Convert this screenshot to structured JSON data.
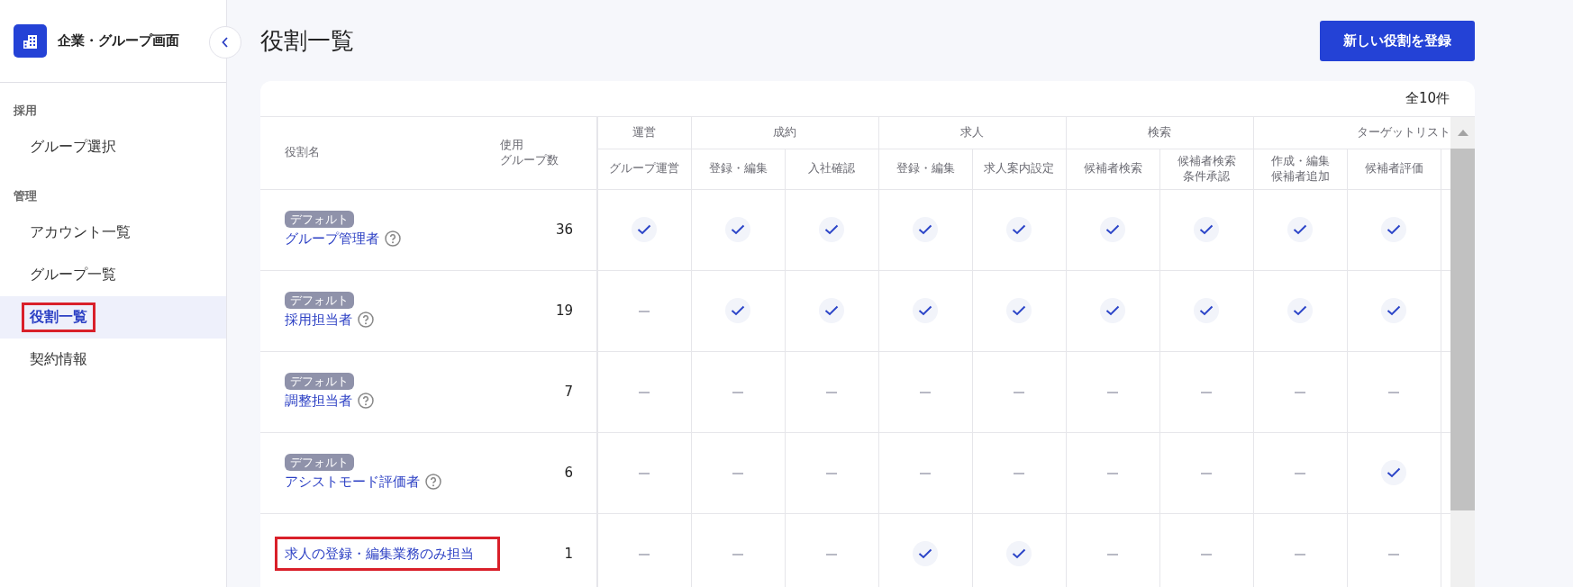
{
  "sidebar": {
    "title": "企業・グループ画面",
    "sections": [
      {
        "label": "採用",
        "items": [
          {
            "label": "グループ選択",
            "selected": false,
            "highlighted": false
          }
        ]
      },
      {
        "label": "管理",
        "items": [
          {
            "label": "アカウント一覧",
            "selected": false,
            "highlighted": false
          },
          {
            "label": "グループ一覧",
            "selected": false,
            "highlighted": false
          },
          {
            "label": "役割一覧",
            "selected": true,
            "highlighted": true
          },
          {
            "label": "契約情報",
            "selected": false,
            "highlighted": false
          }
        ]
      }
    ]
  },
  "page": {
    "title": "役割一覧",
    "primary_button": "新しい役割を登録"
  },
  "table": {
    "total": "全10件",
    "name_header": "役割名",
    "count_header": [
      "使用",
      "グループ数"
    ],
    "groups": [
      {
        "label": "運営",
        "columns": [
          [
            "グループ運営"
          ]
        ]
      },
      {
        "label": "成約",
        "columns": [
          [
            "登録・編集"
          ],
          [
            "入社確認"
          ]
        ]
      },
      {
        "label": "求人",
        "columns": [
          [
            "登録・編集"
          ],
          [
            "求人案内設定"
          ]
        ]
      },
      {
        "label": "検索",
        "columns": [
          [
            "候補者検索"
          ],
          [
            "候補者検索",
            "条件承認"
          ]
        ]
      },
      {
        "label": "ターゲットリスト",
        "columns": [
          [
            "作成・編集",
            "候補者追加"
          ],
          [
            "候補者評価"
          ]
        ]
      }
    ],
    "rows": [
      {
        "badge": "デフォルト",
        "name": "グループ管理者",
        "help": true,
        "highlighted": false,
        "count": "36",
        "permissions": [
          true,
          true,
          true,
          true,
          true,
          true,
          true,
          true,
          true
        ]
      },
      {
        "badge": "デフォルト",
        "name": "採用担当者",
        "help": true,
        "highlighted": false,
        "count": "19",
        "permissions": [
          false,
          true,
          true,
          true,
          true,
          true,
          true,
          true,
          true
        ]
      },
      {
        "badge": "デフォルト",
        "name": "調整担当者",
        "help": true,
        "highlighted": false,
        "count": "7",
        "permissions": [
          false,
          false,
          false,
          false,
          false,
          false,
          false,
          false,
          false
        ]
      },
      {
        "badge": "デフォルト",
        "name": "アシストモード評価者",
        "help": true,
        "highlighted": false,
        "count": "6",
        "permissions": [
          false,
          false,
          false,
          false,
          false,
          false,
          false,
          false,
          true
        ]
      },
      {
        "name": "求人の登録・編集業務のみ担当",
        "help": false,
        "highlighted": true,
        "count": "1",
        "permissions": [
          false,
          false,
          false,
          true,
          true,
          false,
          false,
          false,
          false
        ]
      }
    ]
  }
}
